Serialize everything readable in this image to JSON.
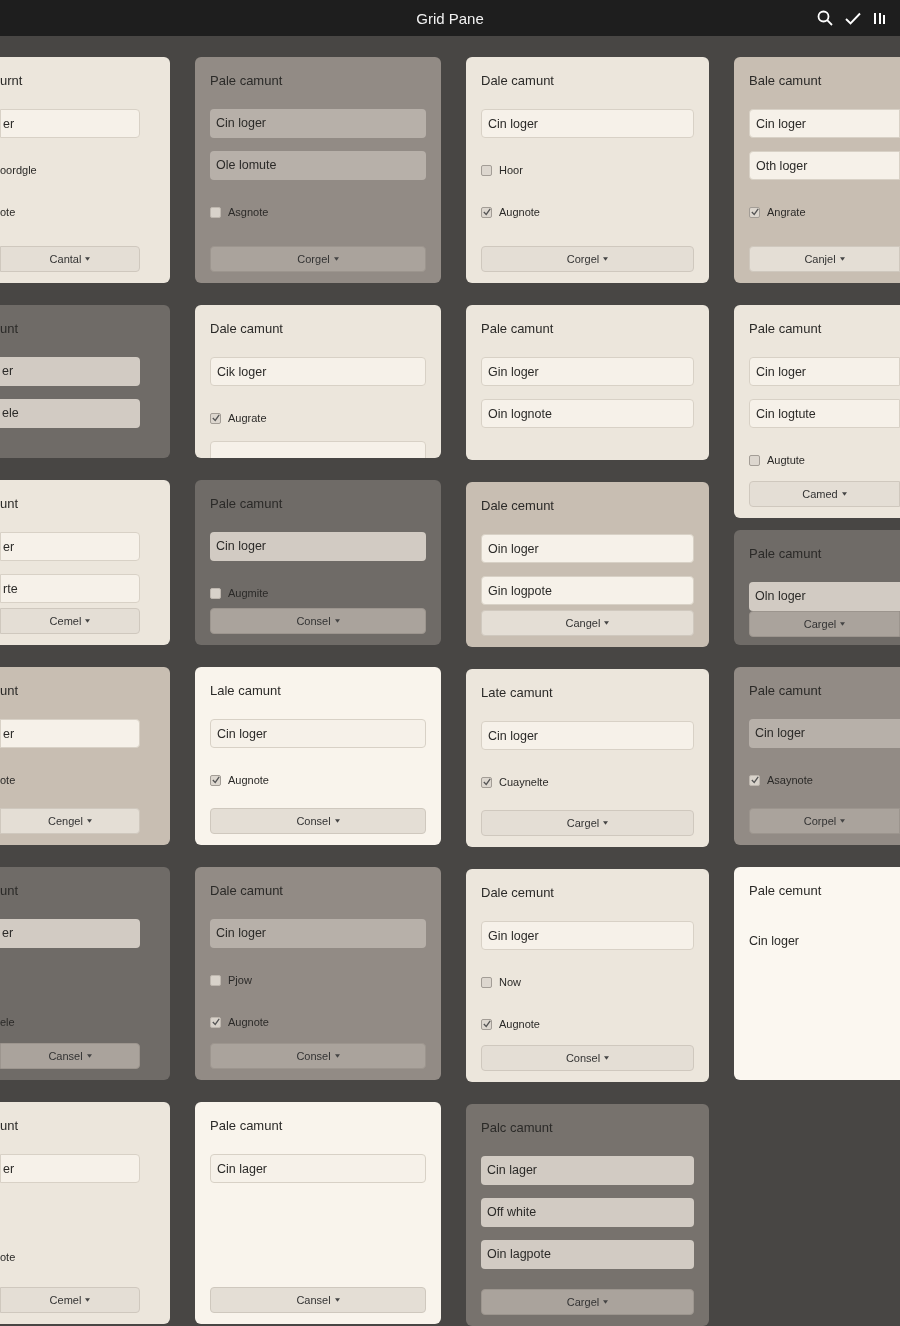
{
  "top_bar": {
    "title": "Grid Pane"
  },
  "columns": [
    {
      "cards": [
        {
          "color": "#ece6dc",
          "title": "urnt",
          "items": [
            {
              "kind": "field",
              "value": "er"
            },
            {
              "kind": "text",
              "text": "oordgle"
            },
            {
              "kind": "text",
              "text": "ote"
            }
          ],
          "button": "Cantal"
        },
        {
          "color": "#6f6b67",
          "title": "unt",
          "items": [
            {
              "kind": "field",
              "value": "er"
            },
            {
              "kind": "field",
              "value": "ele"
            }
          ]
        },
        {
          "color": "#ece6dc",
          "title": "unt",
          "items": [
            {
              "kind": "field",
              "value": "er"
            },
            {
              "kind": "field",
              "value": "rte"
            }
          ],
          "button": "Cemel"
        },
        {
          "color": "#c8beb2",
          "title": "unt",
          "items": [
            {
              "kind": "field",
              "value": "er"
            },
            {
              "kind": "text",
              "text": "ote"
            }
          ],
          "button": "Cengel"
        },
        {
          "color": "#6f6b67",
          "title": "unt",
          "items": [
            {
              "kind": "field",
              "value": "er"
            },
            {
              "kind": "gap"
            },
            {
              "kind": "text",
              "text": "ele"
            }
          ],
          "button": "Cansel"
        },
        {
          "color": "#ece6dc",
          "title": "unt",
          "items": [
            {
              "kind": "field",
              "value": "er"
            },
            {
              "kind": "gap"
            },
            {
              "kind": "text",
              "text": "ote"
            }
          ],
          "button": "Cemel"
        }
      ]
    },
    {
      "cards": [
        {
          "color": "#928b85",
          "title": "Pale camunt",
          "items": [
            {
              "kind": "field",
              "value": "Cin loger"
            },
            {
              "kind": "field",
              "value": "Ole lomute"
            },
            {
              "kind": "check",
              "checked": false,
              "label": "Asgnote"
            }
          ],
          "button": "Corgel"
        },
        {
          "color": "#ece6dc",
          "title": "Dale camunt",
          "items": [
            {
              "kind": "field",
              "value": "Cik loger"
            },
            {
              "kind": "check",
              "checked": true,
              "label": "Augrate"
            },
            {
              "kind": "field"
            }
          ]
        },
        {
          "color": "#6f6b67",
          "title": "Pale camunt",
          "items": [
            {
              "kind": "field",
              "value": "Cin loger"
            },
            {
              "kind": "check",
              "checked": false,
              "label": "Augmite"
            }
          ],
          "button": "Consel"
        },
        {
          "color": "#f9f4ec",
          "title": "Lale camunt",
          "items": [
            {
              "kind": "field",
              "value": "Cin loger"
            },
            {
              "kind": "check",
              "checked": true,
              "label": "Augnote"
            }
          ],
          "button": "Consel"
        },
        {
          "color": "#928b85",
          "title": "Dale camunt",
          "items": [
            {
              "kind": "field",
              "value": "Cin loger"
            },
            {
              "kind": "check",
              "checked": false,
              "label": "Pjow"
            },
            {
              "kind": "check",
              "checked": true,
              "label": "Augnote"
            }
          ],
          "button": "Consel"
        },
        {
          "color": "#f9f4ec",
          "title": "Pale camunt",
          "items": [
            {
              "kind": "field",
              "value": "Cin lager"
            }
          ],
          "button": "Cansel"
        }
      ]
    },
    {
      "cards": [
        {
          "color": "#ece6dc",
          "title": "Dale camunt",
          "items": [
            {
              "kind": "field",
              "value": "Cin loger"
            },
            {
              "kind": "check",
              "checked": false,
              "label": "Hoor"
            },
            {
              "kind": "check",
              "checked": true,
              "label": "Augnote"
            }
          ],
          "button": "Corgel"
        },
        {
          "color": "#ece6dc",
          "title": "Pale camunt",
          "items": [
            {
              "kind": "field",
              "value": "Gin loger"
            },
            {
              "kind": "field",
              "value": "Oin lognote"
            }
          ]
        },
        {
          "color": "#c8beb2",
          "title": "Dale cemunt",
          "items": [
            {
              "kind": "field",
              "value": "Oin loger"
            },
            {
              "kind": "field",
              "value": "Gin logpote"
            }
          ],
          "button": "Cangel"
        },
        {
          "color": "#ece6dc",
          "title": "Late camunt",
          "items": [
            {
              "kind": "field",
              "value": "Cin loger"
            },
            {
              "kind": "check",
              "checked": true,
              "label": "Cuaynelte"
            }
          ],
          "button": "Cargel"
        },
        {
          "color": "#ece6dc",
          "title": "Dale cemunt",
          "items": [
            {
              "kind": "field",
              "value": "Gin loger"
            },
            {
              "kind": "check",
              "checked": false,
              "label": "Now"
            },
            {
              "kind": "check",
              "checked": true,
              "label": "Augnote"
            }
          ],
          "button": "Consel"
        },
        {
          "color": "#77726d",
          "title": "Palc camunt",
          "items": [
            {
              "kind": "field",
              "value": "Cin lager"
            },
            {
              "kind": "field",
              "value": "Off white"
            },
            {
              "kind": "field",
              "value": "Oin lagpote"
            }
          ],
          "button": "Cargel"
        }
      ]
    },
    {
      "cards": [
        {
          "color": "#c8beb2",
          "title": "Bale camunt",
          "items": [
            {
              "kind": "field",
              "value": "Cin loger"
            },
            {
              "kind": "field",
              "value": "Oth loger"
            },
            {
              "kind": "check",
              "checked": true,
              "label": "Angrate"
            }
          ],
          "button": "Canjel"
        },
        {
          "color": "#ece6dc",
          "title": "Pale camunt",
          "items": [
            {
              "kind": "field",
              "value": "Cin loger"
            },
            {
              "kind": "field",
              "value": "Cin logtute"
            },
            {
              "kind": "check",
              "checked": false,
              "label": "Augtute"
            }
          ],
          "button": "Camed"
        },
        {
          "color": "#6f6b67",
          "title": "Pale camunt",
          "items": [
            {
              "kind": "field",
              "value": "Oln loger"
            }
          ],
          "button": "Cargel"
        },
        {
          "color": "#928b85",
          "title": "Pale camunt",
          "items": [
            {
              "kind": "field",
              "value": "Cin loger"
            },
            {
              "kind": "check",
              "checked": true,
              "label": "Asaynote"
            }
          ],
          "button": "Corpel"
        },
        {
          "color": "#fbf7f0",
          "title": "Pale cemunt",
          "items": [
            {
              "kind": "text",
              "text": "Cin loger"
            }
          ]
        }
      ]
    }
  ]
}
